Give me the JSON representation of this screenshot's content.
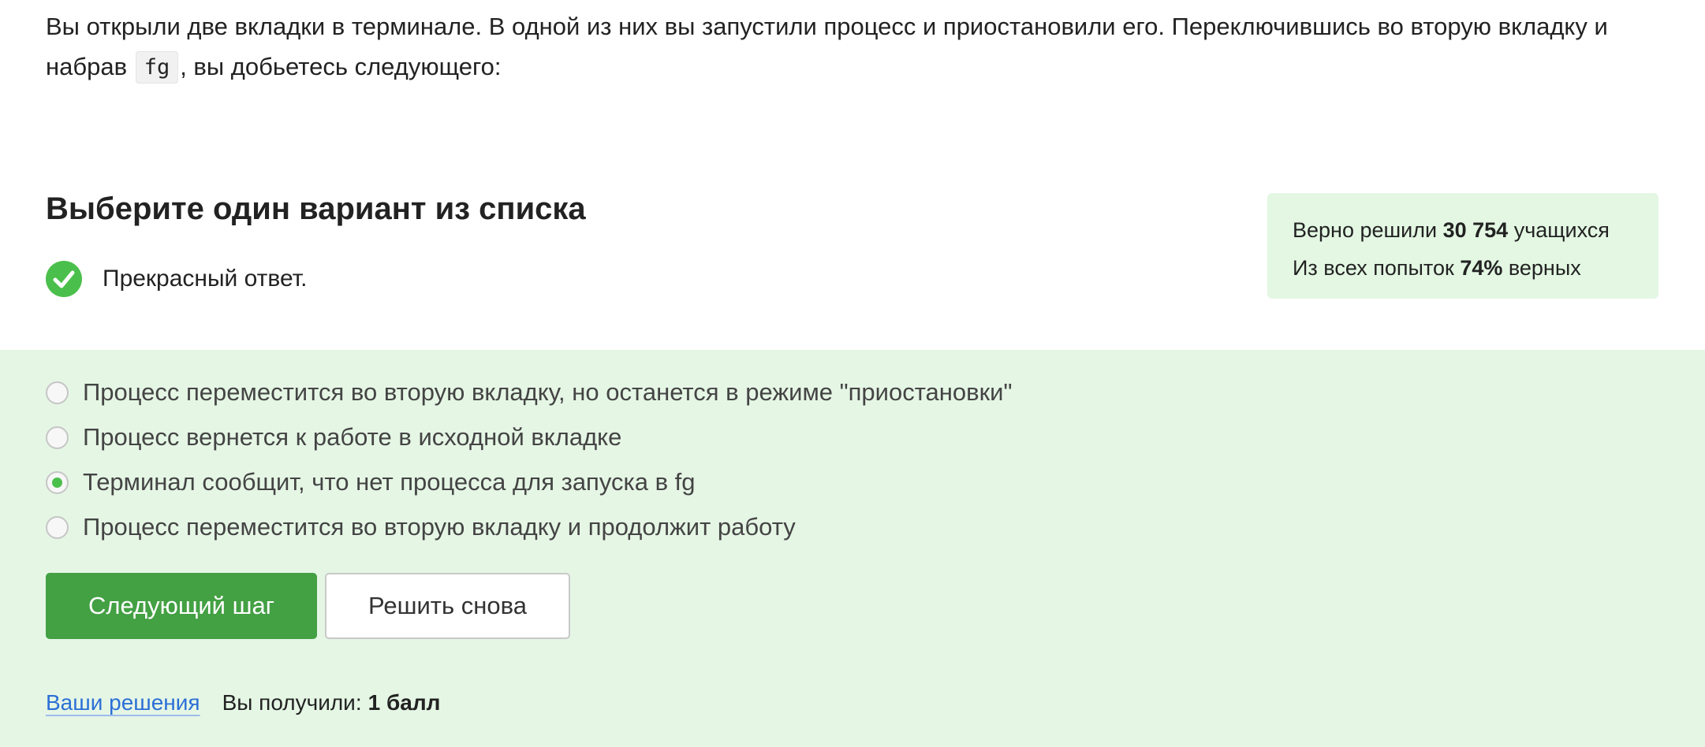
{
  "question": {
    "text_before_code": "Вы открыли две вкладки в терминале. В одной из них вы запустили процесс и приостановили его. Переключившись во вторую вкладку и набрав ",
    "code": "fg",
    "text_after_code": ", вы добьетесь следующего:"
  },
  "heading": "Выберите один вариант из списка",
  "result": {
    "icon": "check-circle-icon",
    "text": "Прекрасный ответ."
  },
  "stats": {
    "line1_prefix": "Верно решили ",
    "solved_count": "30 754",
    "line1_suffix": " учащихся",
    "line2_prefix": "Из всех попыток ",
    "correct_percent": "74%",
    "line2_suffix": " верных"
  },
  "options": [
    {
      "label": "Процесс переместится во вторую вкладку, но останется в режиме \"приостановки\"",
      "selected": false
    },
    {
      "label": "Процесс вернется к работе в исходной вкладке",
      "selected": false
    },
    {
      "label": "Терминал сообщит, что нет процесса для запуска в fg",
      "selected": true
    },
    {
      "label": "Процесс переместится во вторую вкладку и продолжит работу",
      "selected": false
    }
  ],
  "buttons": {
    "next": "Следующий шаг",
    "retry": "Решить снова"
  },
  "footer": {
    "solutions_link": "Ваши решения",
    "score_prefix": "Вы получили: ",
    "score_value": "1 балл"
  },
  "colors": {
    "accent_green": "#43a043",
    "success_green": "#4bbf4b",
    "panel_bg": "#e5f6e5",
    "stats_bg": "#e3f7e3",
    "link_blue": "#2c6fd6"
  }
}
